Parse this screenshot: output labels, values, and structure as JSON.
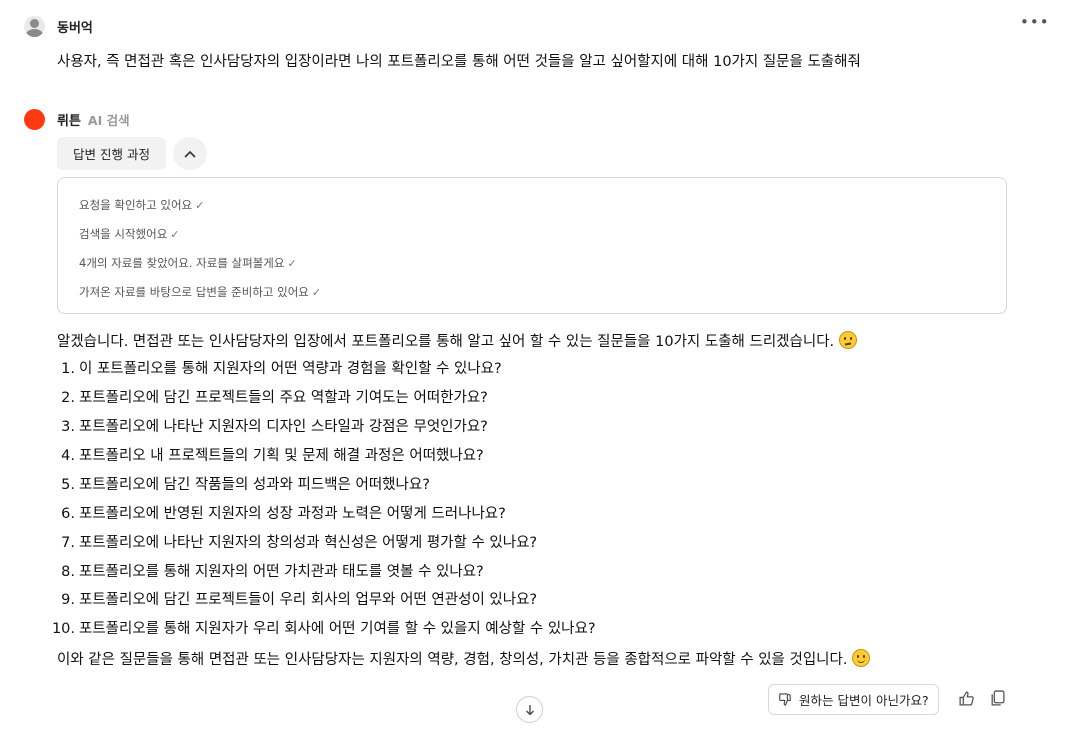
{
  "user": {
    "name": "동버억",
    "question": "사용자, 즉 면접관 혹은 인사담당자의 입장이라면 나의 포트폴리오를 통해 어떤 것들을 알고 싶어할지에 대해 10가지 질문을 도출해줘"
  },
  "bot": {
    "name": "뤼튼",
    "badge": "AI 검색",
    "progress_label": "답변 진행 과정"
  },
  "steps": [
    "요청을 확인하고 있어요",
    "검색을 시작했어요",
    "4개의 자료를 찾았어요. 자료를 살펴볼게요",
    "가져온 자료를 바탕으로 답변을 준비하고 있어요"
  ],
  "answer": {
    "intro": "알겠습니다. 면접관 또는 인사담당자의 입장에서 포트폴리오를 통해 알고 싶어 할 수 있는 질문들을 10가지 도출해 드리겠습니다.",
    "items": [
      "이 포트폴리오를 통해 지원자의 어떤 역량과 경험을 확인할 수 있나요?",
      "포트폴리오에 담긴 프로젝트들의 주요 역할과 기여도는 어떠한가요?",
      "포트폴리오에 나타난 지원자의 디자인 스타일과 강점은 무엇인가요?",
      "포트폴리오 내 프로젝트들의 기획 및 문제 해결 과정은 어떠했나요?",
      "포트폴리오에 담긴 작품들의 성과와 피드백은 어떠했나요?",
      "포트폴리오에 반영된 지원자의 성장 과정과 노력은 어떻게 드러나나요?",
      "포트폴리오에 나타난 지원자의 창의성과 혁신성은 어떻게 평가할 수 있나요?",
      "포트폴리오를 통해 지원자의 어떤 가치관과 태도를 엿볼 수 있나요?",
      "포트폴리오에 담긴 프로젝트들이 우리 회사의 업무와 어떤 연관성이 있나요?",
      "포트폴리오를 통해 지원자가 우리 회사에 어떤 기여를 할 수 있을지 예상할 수 있나요?"
    ],
    "numbers": [
      "1.",
      "2.",
      "3.",
      "4.",
      "5.",
      "6.",
      "7.",
      "8.",
      "9.",
      "10."
    ],
    "outro": "이와 같은 질문들을 통해 면접관 또는 인사담당자는 지원자의 역량, 경험, 창의성, 가치관 등을 종합적으로 파악할 수 있을 것입니다."
  },
  "actions": {
    "feedback_label": "원하는 답변이 아닌가요?"
  },
  "icons": {
    "more": "more-icon",
    "collapse": "chevron-up-icon",
    "check": "check-icon",
    "feedback": "thumbs-down-icon",
    "like": "thumbs-up-icon",
    "copy": "copy-icon",
    "scroll": "arrow-down-icon"
  },
  "colors": {
    "bot_avatar": "#ff3a12",
    "user_avatar": "#8a8a8a"
  }
}
